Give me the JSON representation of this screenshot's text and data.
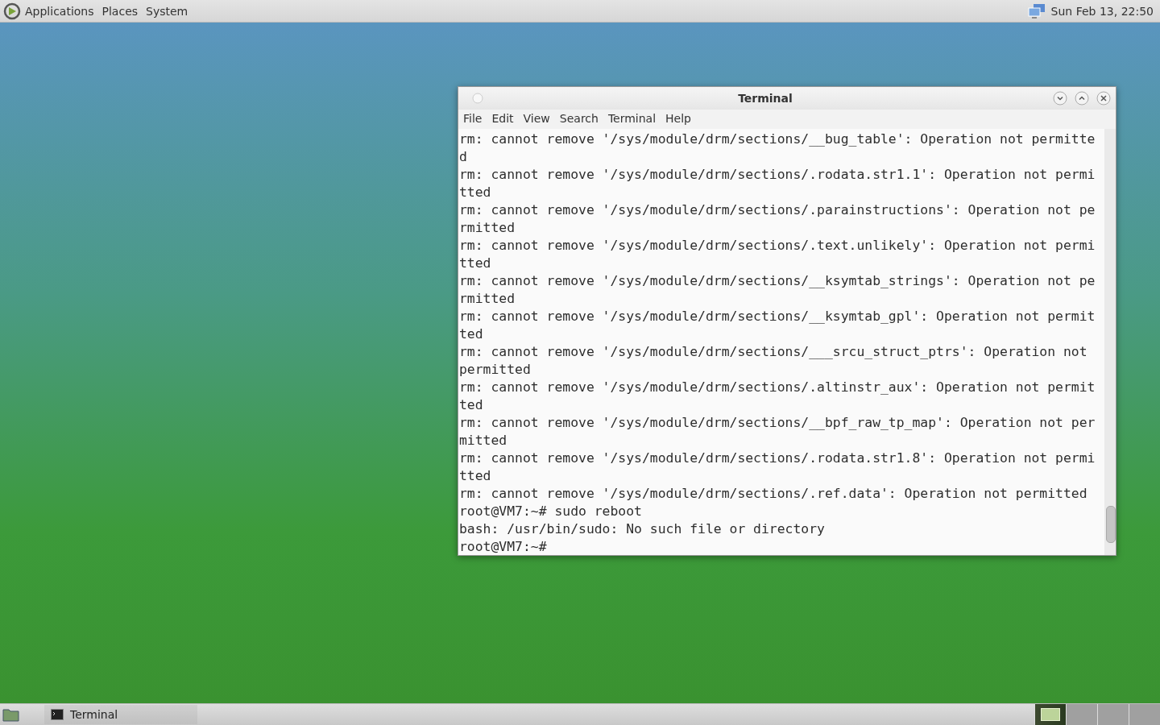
{
  "top_panel": {
    "menus": [
      "Applications",
      "Places",
      "System"
    ],
    "clock": "Sun Feb 13, 22:50"
  },
  "window": {
    "title": "Terminal",
    "menu": [
      "File",
      "Edit",
      "View",
      "Search",
      "Terminal",
      "Help"
    ],
    "lines": [
      "rm: cannot remove '/sys/module/drm/sections/__bug_table': Operation not permitte",
      "d",
      "rm: cannot remove '/sys/module/drm/sections/.rodata.str1.1': Operation not permi",
      "tted",
      "rm: cannot remove '/sys/module/drm/sections/.parainstructions': Operation not pe",
      "rmitted",
      "rm: cannot remove '/sys/module/drm/sections/.text.unlikely': Operation not permi",
      "tted",
      "rm: cannot remove '/sys/module/drm/sections/__ksymtab_strings': Operation not pe",
      "rmitted",
      "rm: cannot remove '/sys/module/drm/sections/__ksymtab_gpl': Operation not permit",
      "ted",
      "rm: cannot remove '/sys/module/drm/sections/___srcu_struct_ptrs': Operation not",
      "permitted",
      "rm: cannot remove '/sys/module/drm/sections/.altinstr_aux': Operation not permit",
      "ted",
      "rm: cannot remove '/sys/module/drm/sections/__bpf_raw_tp_map': Operation not per",
      "mitted",
      "rm: cannot remove '/sys/module/drm/sections/.rodata.str1.8': Operation not permi",
      "tted",
      "rm: cannot remove '/sys/module/drm/sections/.ref.data': Operation not permitted",
      "root@VM7:~# sudo reboot",
      "bash: /usr/bin/sudo: No such file or directory",
      "root@VM7:~# "
    ]
  },
  "bottom_panel": {
    "tasks": [
      {
        "label": "Terminal",
        "selected": false
      }
    ],
    "workspaces": [
      {
        "selected": true
      },
      {
        "selected": false
      },
      {
        "selected": false
      },
      {
        "selected": false
      }
    ]
  }
}
